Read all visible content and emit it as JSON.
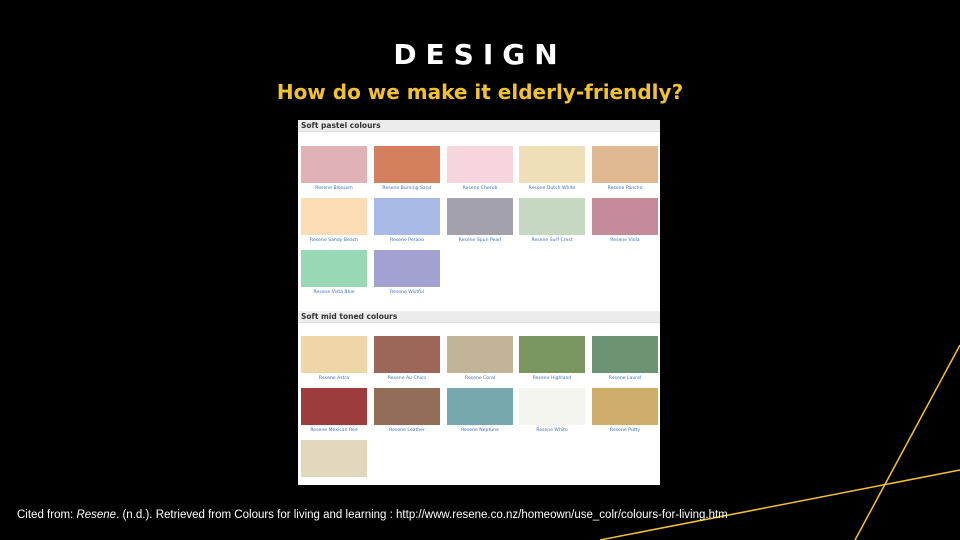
{
  "slide": {
    "title": "DESIGN",
    "subtitle": "How do we make it elderly-friendly?",
    "accent_color": "#f2c12e",
    "background_color": "#000000"
  },
  "sections": [
    {
      "heading": "Soft pastel colours",
      "swatches": [
        {
          "name": "Resene Blossom",
          "color": "#e0b2b8"
        },
        {
          "name": "Resene Burning Sand",
          "color": "#d4805f"
        },
        {
          "name": "Resene Cherub",
          "color": "#f6d6dc"
        },
        {
          "name": "Resene Dutch White",
          "color": "#efdfb8"
        },
        {
          "name": "Resene Pancho",
          "color": "#e0b992"
        },
        {
          "name": "Resene Sandy Beach",
          "color": "#fcdcb4"
        },
        {
          "name": "Resene Perano",
          "color": "#a9b9e6"
        },
        {
          "name": "Resene Spun Pearl",
          "color": "#a3a2ac"
        },
        {
          "name": "Resene Surf Crest",
          "color": "#c6d8c2"
        },
        {
          "name": "Resene Viola",
          "color": "#c48c9a"
        },
        {
          "name": "Resene Vista Blue",
          "color": "#99d8b4"
        },
        {
          "name": "Resene Wistful",
          "color": "#a3a0d2"
        }
      ]
    },
    {
      "heading": "Soft mid toned colours",
      "swatches": [
        {
          "name": "Resene Astra",
          "color": "#efd6a6"
        },
        {
          "name": "Resene Au Chico",
          "color": "#9c6658"
        },
        {
          "name": "Resene Coral",
          "color": "#c2b497"
        },
        {
          "name": "Resene Highland",
          "color": "#7a9660"
        },
        {
          "name": "Resene Laurel",
          "color": "#6c9374"
        },
        {
          "name": "Resene Mexican Red",
          "color": "#9c3c3c"
        },
        {
          "name": "Resene Leather",
          "color": "#926e58"
        },
        {
          "name": "Resene Neptune",
          "color": "#76a8ad"
        },
        {
          "name": "Resene White",
          "color": "#f5f5f0"
        },
        {
          "name": "Resene Putty",
          "color": "#cfad6b"
        },
        {
          "name": "",
          "color": "#e2d6bc"
        }
      ]
    }
  ],
  "citation": {
    "prefix": "Cited from: ",
    "source": "Resene",
    "rest": ". (n.d.). Retrieved from Colours for living and learning : http://www.resene.co.nz/homeown/use_colr/colours-for-living.htm"
  }
}
